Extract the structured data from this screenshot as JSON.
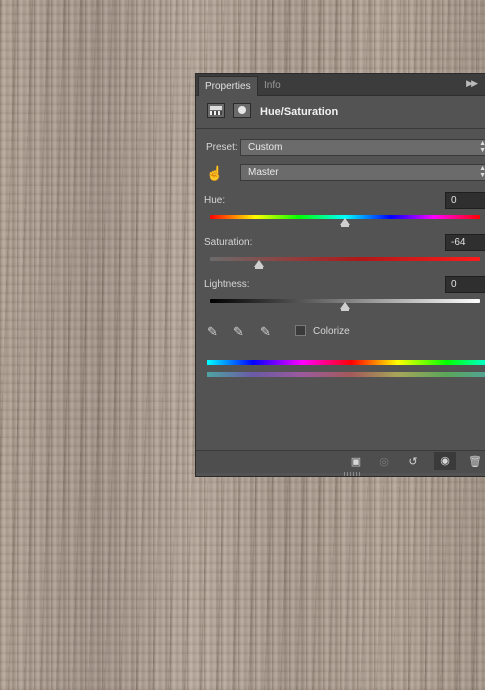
{
  "panel": {
    "tabs": [
      {
        "label": "Properties"
      },
      {
        "label": "Info"
      }
    ],
    "collapse_icon": "double-chevron-right-icon",
    "title": "Hue/Saturation",
    "preset": {
      "label": "Preset:",
      "value": "Custom"
    },
    "channel": {
      "value": "Master"
    },
    "hue": {
      "label": "Hue:",
      "value": "0",
      "level": 0.5
    },
    "saturation": {
      "label": "Saturation:",
      "value": "-64",
      "level": 0.18
    },
    "lightness": {
      "label": "Lightness:",
      "value": "0",
      "level": 0.5
    },
    "colorize": {
      "label": "Colorize",
      "checked": false
    },
    "footer_icons": [
      "clip-to-layer-icon",
      "view-previous-state-icon",
      "reset-icon",
      "toggle-visibility-icon",
      "delete-icon"
    ]
  }
}
